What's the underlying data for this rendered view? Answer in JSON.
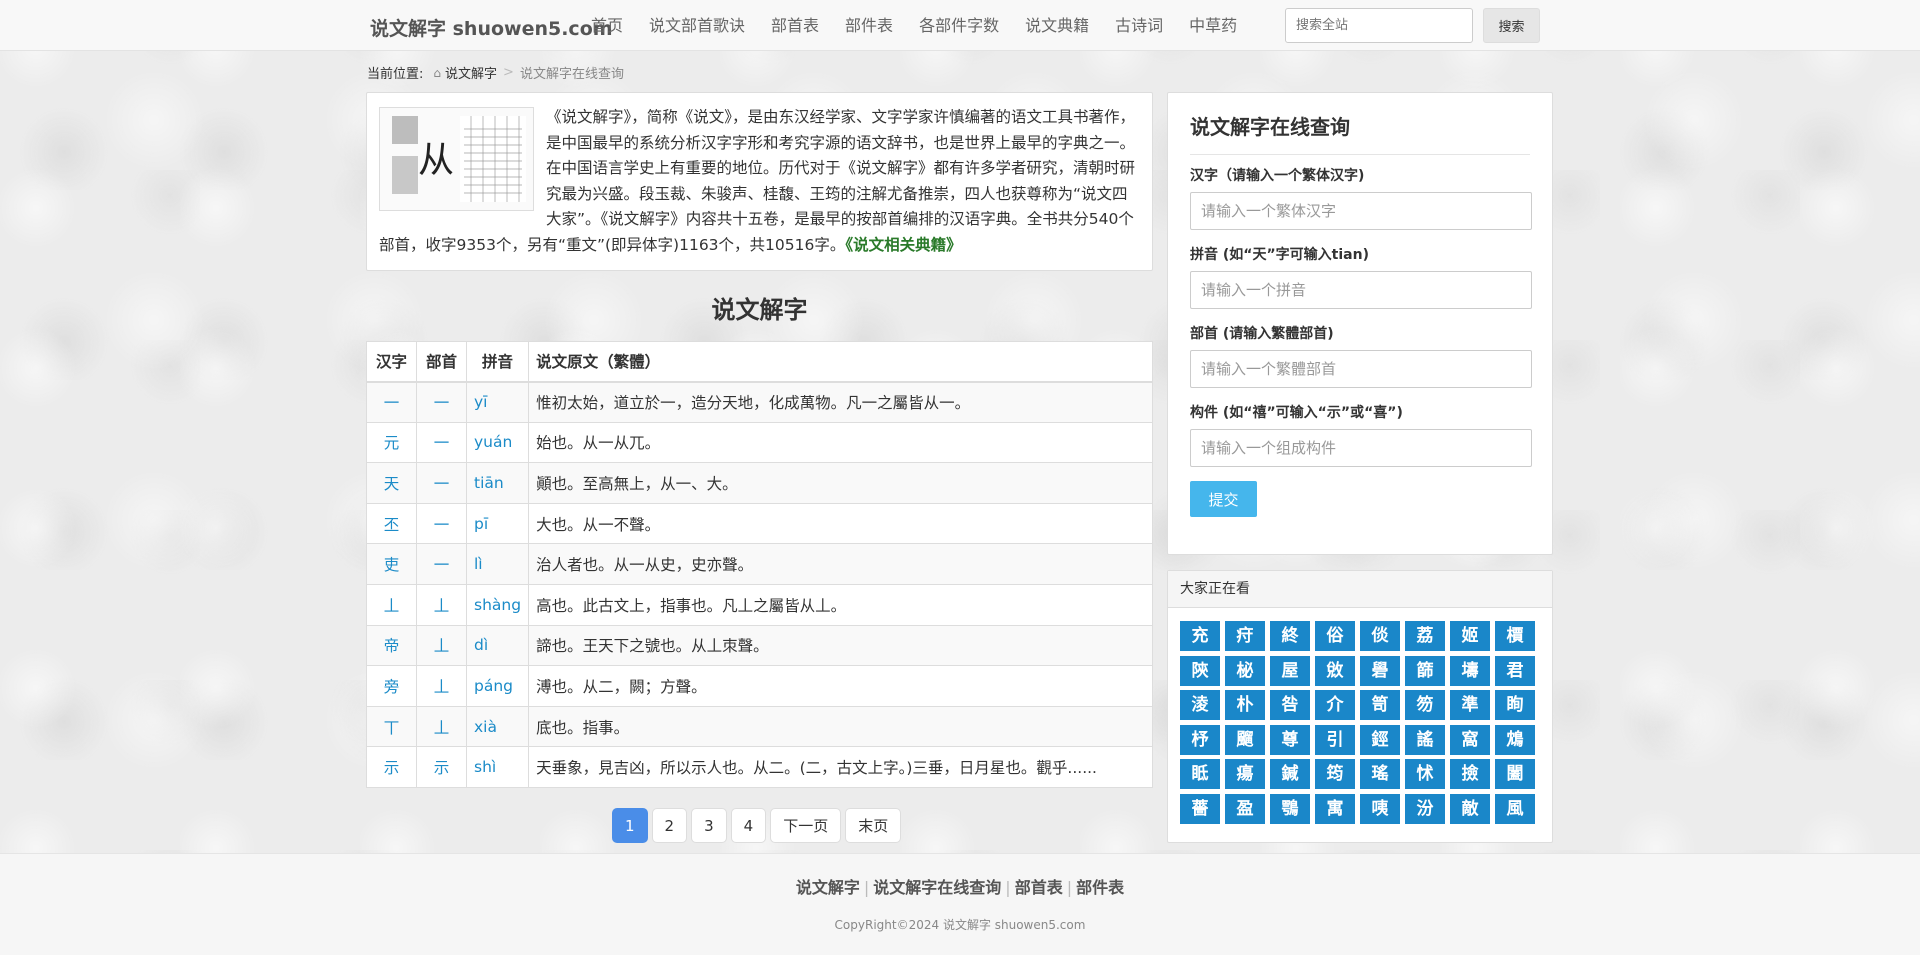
{
  "navbar": {
    "brand": "说文解字 shuowen5.com",
    "links": [
      "首页",
      "说文部首歌诀",
      "部首表",
      "部件表",
      "各部件字数",
      "说文典籍",
      "古诗词",
      "中草药"
    ],
    "search_placeholder": "搜索全站",
    "search_button": "搜索"
  },
  "breadcrumb": {
    "prefix": "当前位置:",
    "home": "说文解字",
    "separator": ">",
    "current": "说文解字在线查询"
  },
  "intro": {
    "text": "《说文解字》，简称《说文》，是由东汉经学家、文字学家许慎编著的语文工具书著作，是中国最早的系统分析汉字字形和考究字源的语文辞书，也是世界上最早的字典之一。在中国语言学史上有重要的地位。历代对于《说文解字》都有许多学者研究，清朝时研究最为兴盛。段玉裁、朱骏声、桂馥、王筠的注解尤备推崇，四人也获尊称为“说文四大家”。《说文解字》内容共十五卷，是最早的按部首编排的汉语字典。全书共分540个部首，收字9353个，另有“重文”(即异体字)1163个，共10516字。",
    "link": "《说文相关典籍》",
    "image_glyph": "从"
  },
  "main_title": "说文解字",
  "table": {
    "headers": [
      "汉字",
      "部首",
      "拼音",
      "说文原文（繁體）"
    ],
    "rows": [
      {
        "char": "一",
        "radical": "一",
        "pinyin": "yī",
        "text": "惟初太始，道立於一，造分天地，化成萬物。凡一之屬皆从一。"
      },
      {
        "char": "元",
        "radical": "一",
        "pinyin": "yuán",
        "text": "始也。从一从兀。"
      },
      {
        "char": "天",
        "radical": "一",
        "pinyin": "tiān",
        "text": "顚也。至高無上，从一、大。"
      },
      {
        "char": "丕",
        "radical": "一",
        "pinyin": "pī",
        "text": "大也。从一不聲。"
      },
      {
        "char": "吏",
        "radical": "一",
        "pinyin": "lì",
        "text": "治人者也。从一从史，史亦聲。"
      },
      {
        "char": "丄",
        "radical": "丄",
        "pinyin": "shàng",
        "text": "高也。此古文上，指事也。凡丄之屬皆从丄。"
      },
      {
        "char": "帝",
        "radical": "丄",
        "pinyin": "dì",
        "text": "諦也。王天下之號也。从丄朿聲。"
      },
      {
        "char": "旁",
        "radical": "丄",
        "pinyin": "páng",
        "text": "溥也。从二，闕；方聲。"
      },
      {
        "char": "丅",
        "radical": "丄",
        "pinyin": "xià",
        "text": "底也。指事。"
      },
      {
        "char": "示",
        "radical": "示",
        "pinyin": "shì",
        "text": "天垂象，見吉凶，所以示人也。从二。(二，古文上字。)三垂，日月星也。觀乎......"
      }
    ]
  },
  "pagination": {
    "pages": [
      "1",
      "2",
      "3",
      "4"
    ],
    "current": "1",
    "next": "下一页",
    "last": "末页"
  },
  "side_search": {
    "title": "说文解字在线查询",
    "fields": [
      {
        "label": "汉字（请输入一个繁体汉字)",
        "placeholder": "请输入一个繁体汉字"
      },
      {
        "label": "拼音 (如“天”字可输入tian)",
        "placeholder": "请输入一个拼音"
      },
      {
        "label": "部首 (请输入繁體部首)",
        "placeholder": "请输入一个繁體部首"
      },
      {
        "label": "构件 (如“禧”可输入“示”或“喜”)",
        "placeholder": "请输入一个组成构件"
      }
    ],
    "submit": "提交"
  },
  "popular": {
    "title": "大家正在看",
    "chars": [
      "充",
      "疛",
      "終",
      "俗",
      "倓",
      "荔",
      "姬",
      "檟",
      "陝",
      "柲",
      "屋",
      "敓",
      "礐",
      "篩",
      "壔",
      "君",
      "淩",
      "朴",
      "咎",
      "介",
      "笥",
      "笏",
      "準",
      "眴",
      "杼",
      "飀",
      "尊",
      "引",
      "鋞",
      "謠",
      "窩",
      "鴆",
      "眡",
      "瘍",
      "鍼",
      "筠",
      "瑤",
      "怵",
      "撿",
      "闔",
      "薔",
      "盈",
      "鶚",
      "寓",
      "咦",
      "汾",
      "敵",
      "風"
    ]
  },
  "footer": {
    "links": [
      "说文解字",
      "说文解字在线查询",
      "部首表",
      "部件表"
    ],
    "separator": "|",
    "copyright": "CopyRight©2024 说文解字 shuowen5.com"
  },
  "colors": {
    "link_blue": "#1b8bc8",
    "tile_blue": "#1a87c9",
    "active_page": "#4a8de8",
    "submit_blue": "#45b6ec",
    "book_link_green": "#2a7a2a"
  }
}
